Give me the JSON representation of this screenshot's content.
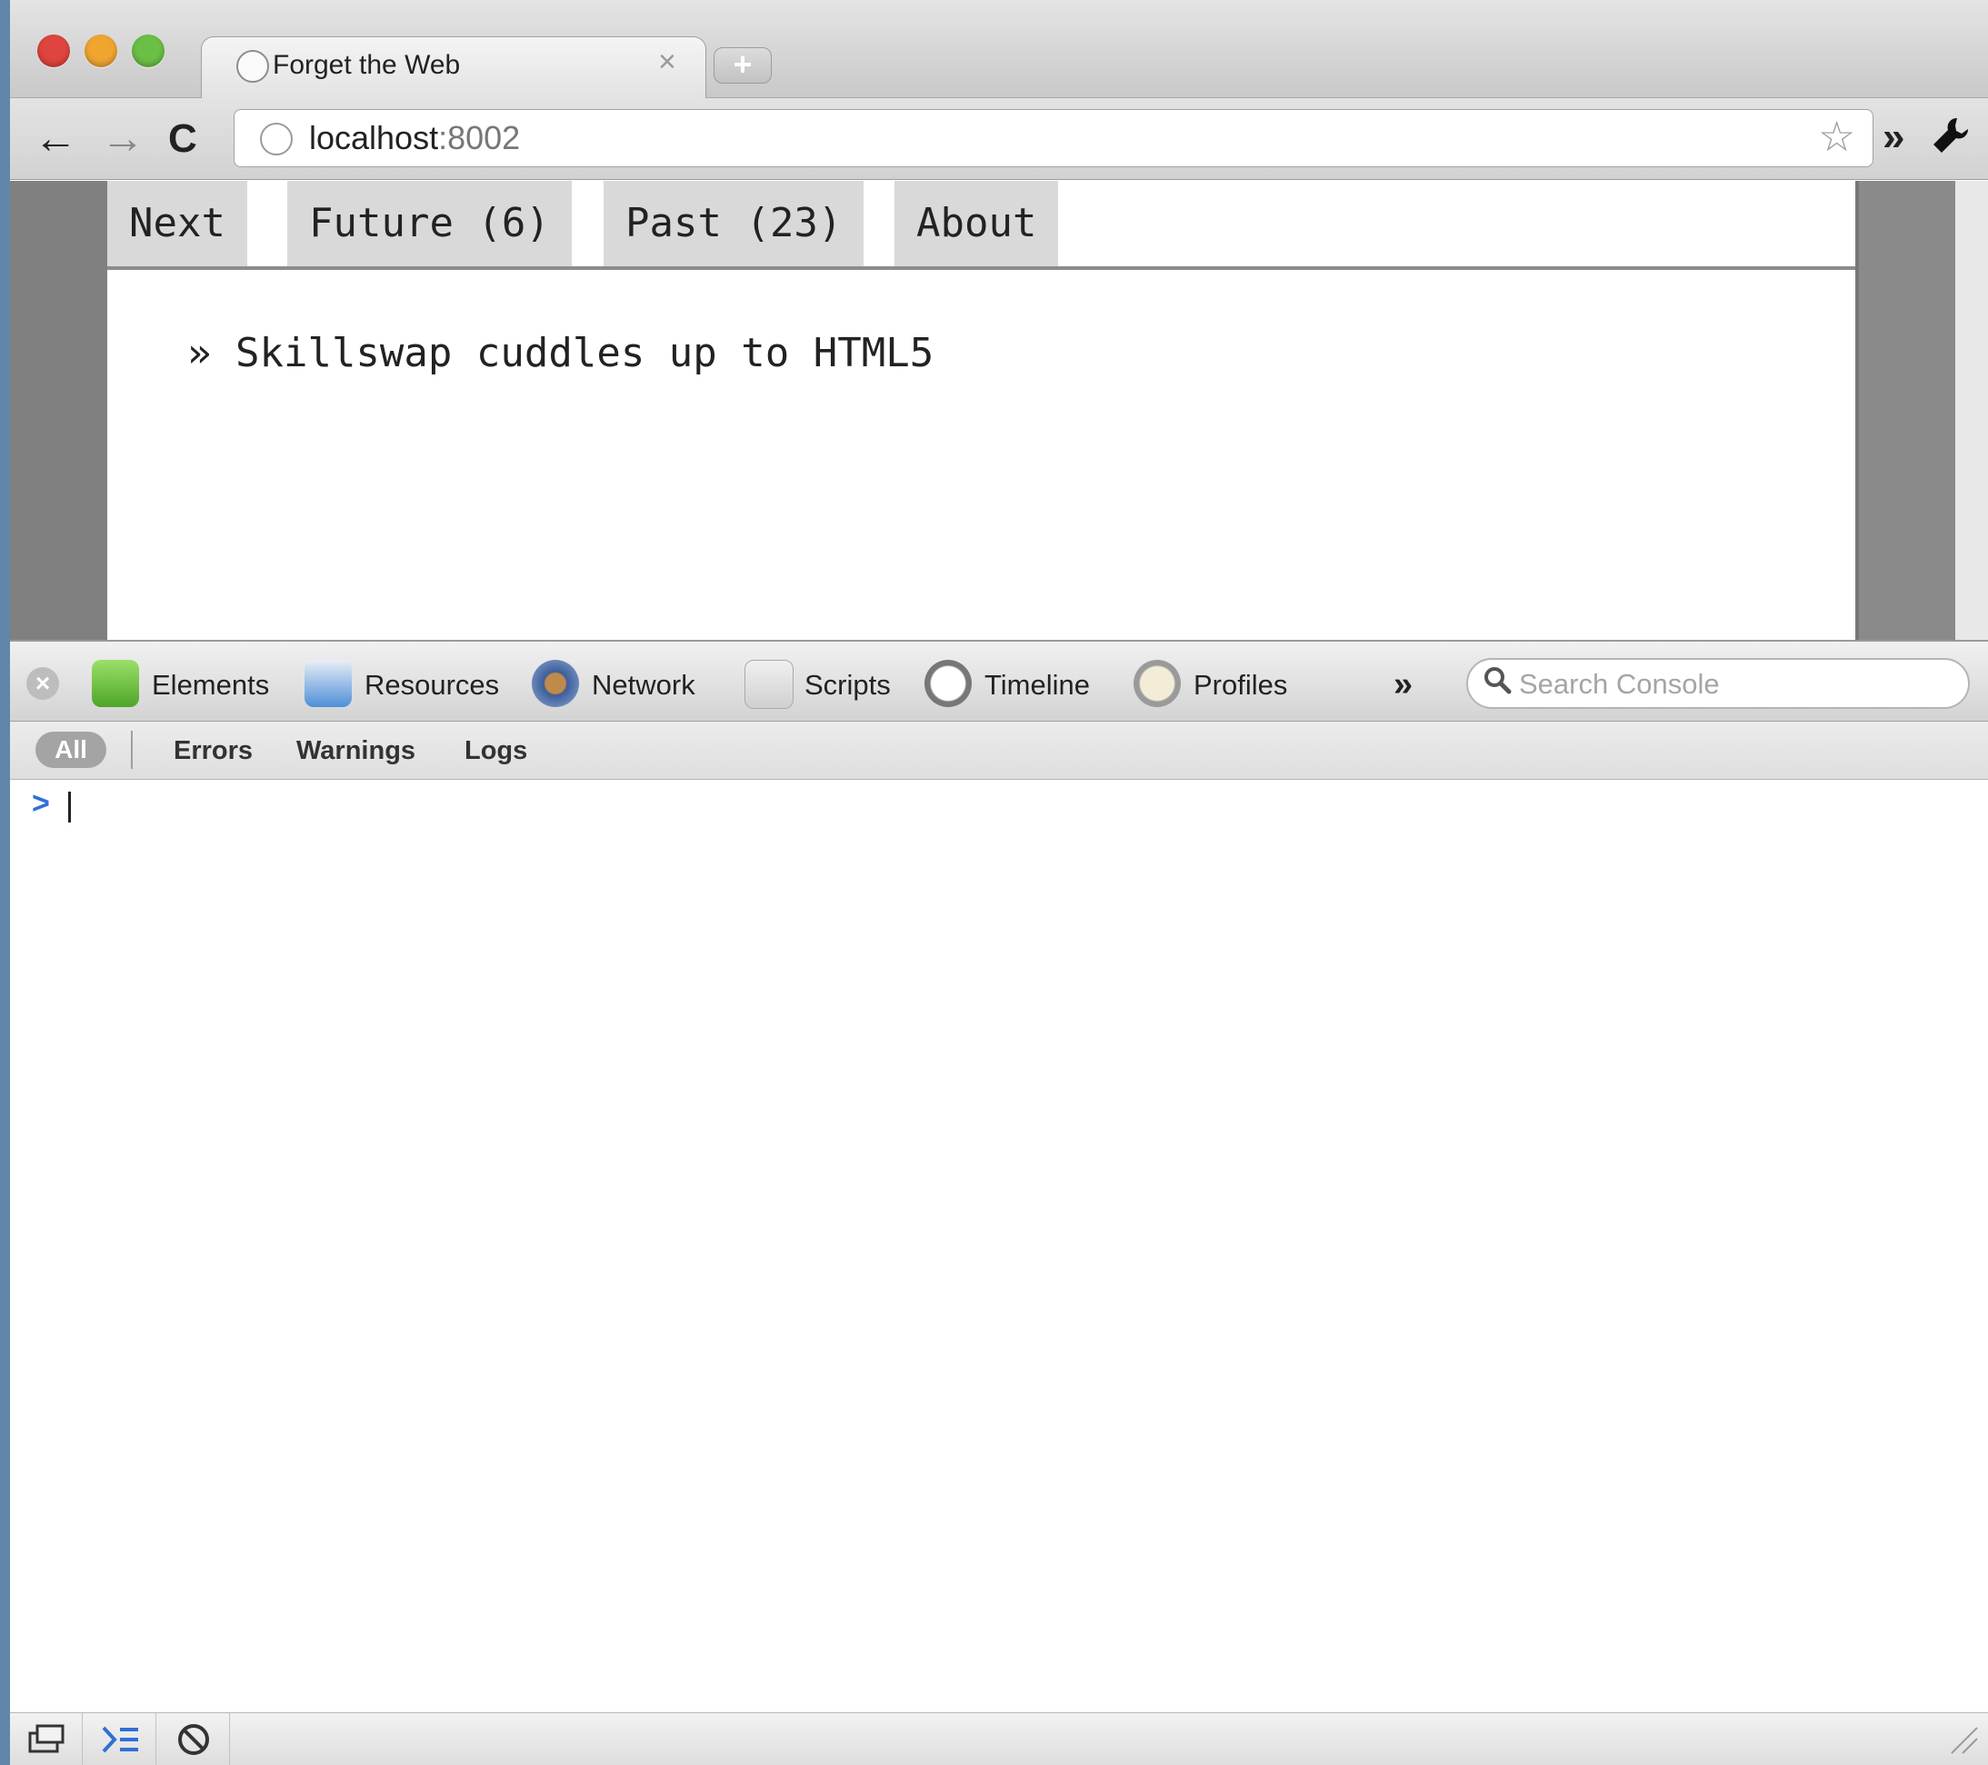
{
  "window": {
    "tab": {
      "title": "Forget the Web",
      "close_glyph": "×"
    },
    "new_tab_glyph": "+"
  },
  "toolbar": {
    "back_glyph": "←",
    "forward_glyph": "→",
    "reload_glyph": "C",
    "url_host": "localhost",
    "url_port": ":8002",
    "more_glyph": "»"
  },
  "page": {
    "nav": [
      "Next",
      "Future (6)",
      "Past (23)",
      "About"
    ],
    "headline": "» Skillswap cuddles up to HTML5"
  },
  "devtools": {
    "tabs": [
      {
        "label": "Elements",
        "icon": "elements-icon",
        "color": "#6cbf3c"
      },
      {
        "label": "Resources",
        "icon": "resources-icon",
        "color": "#4f8fd8"
      },
      {
        "label": "Network",
        "icon": "network-icon",
        "color": "#3d5e9c"
      },
      {
        "label": "Scripts",
        "icon": "scripts-icon",
        "color": "#d84040"
      },
      {
        "label": "Timeline",
        "icon": "timeline-icon",
        "color": "#c0392b"
      },
      {
        "label": "Profiles",
        "icon": "profiles-icon",
        "color": "#c9b37a"
      }
    ],
    "more_glyph": "»",
    "search_placeholder": "Search Console",
    "filters": {
      "all": "All",
      "errors": "Errors",
      "warnings": "Warnings",
      "logs": "Logs"
    },
    "prompt_glyph": ">"
  },
  "colors": {
    "accent": "#2f6fd6",
    "close_light": "#e0443e",
    "minimize_light": "#f0a531",
    "zoom_light": "#6bbf45"
  }
}
